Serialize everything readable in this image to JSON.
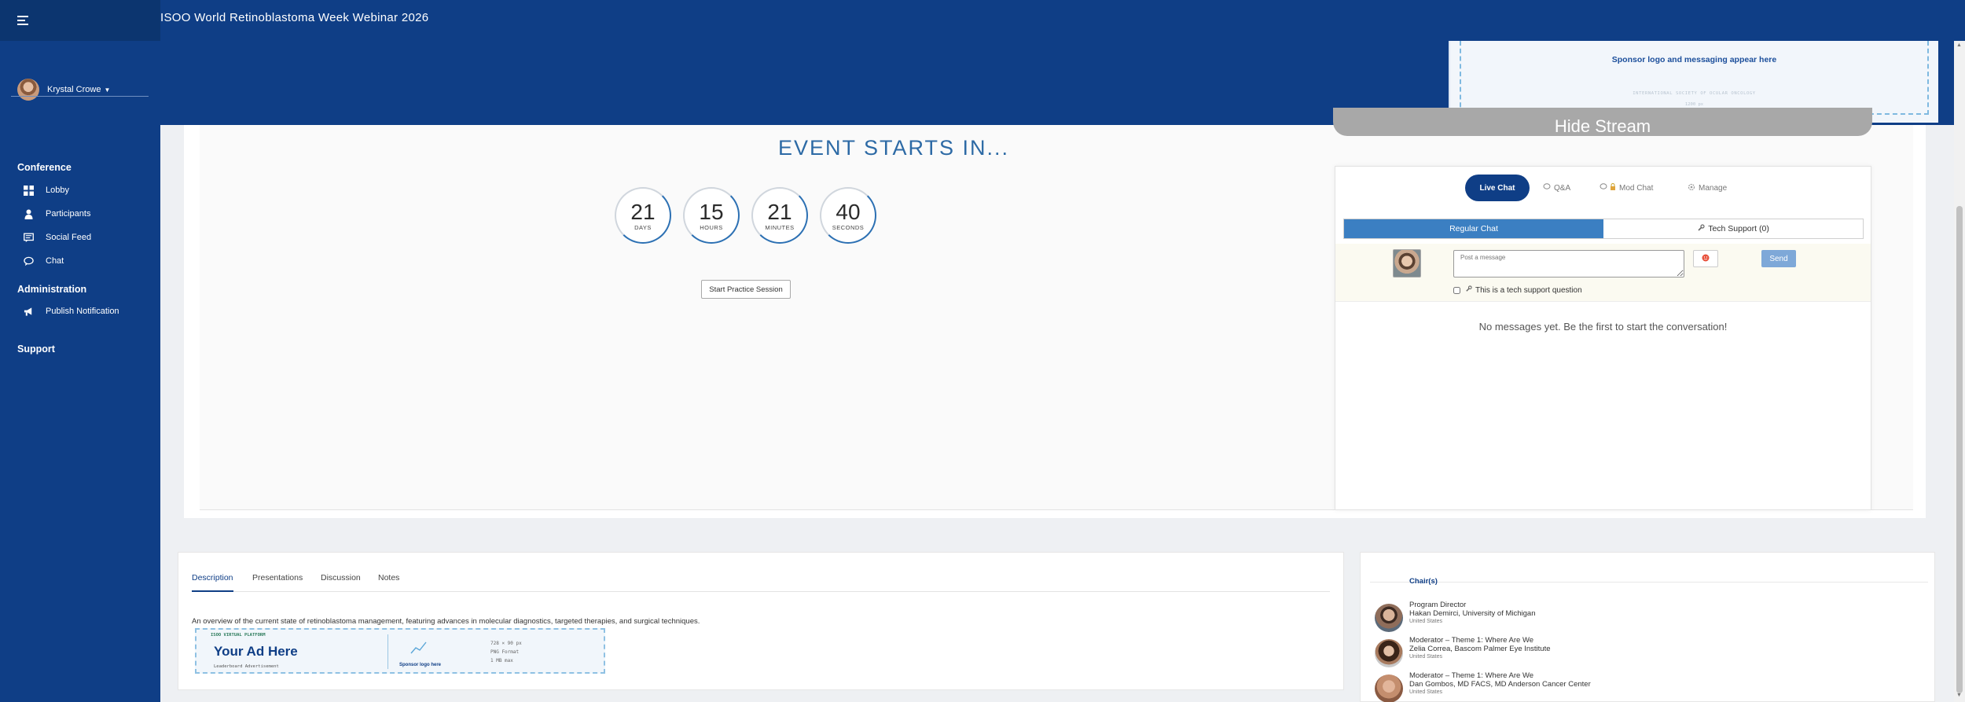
{
  "app": {
    "event_title": "ISOO World Retinoblastoma Week Webinar 2026"
  },
  "user": {
    "name": "Krystal Crowe"
  },
  "sidebar": {
    "sections": [
      {
        "title": "Conference",
        "items": [
          {
            "label": "Lobby",
            "icon": "grid-icon"
          },
          {
            "label": "Participants",
            "icon": "person-icon"
          },
          {
            "label": "Social Feed",
            "icon": "feed-icon"
          },
          {
            "label": "Chat",
            "icon": "chat-bubble-icon"
          }
        ]
      },
      {
        "title": "Administration",
        "items": [
          {
            "label": "Publish Notification",
            "icon": "megaphone-icon"
          }
        ]
      },
      {
        "title": "Support",
        "items": []
      }
    ]
  },
  "sponsor_banner": {
    "text": "Sponsor logo and messaging appear here",
    "sub": "INTERNATIONAL SOCIETY OF OCULAR ONCOLOGY",
    "size": "1200 px"
  },
  "countdown": {
    "title": "EVENT STARTS IN...",
    "units": [
      {
        "value": "21",
        "label": "DAYS"
      },
      {
        "value": "15",
        "label": "HOURS"
      },
      {
        "value": "21",
        "label": "MINUTES"
      },
      {
        "value": "40",
        "label": "SECONDS"
      }
    ],
    "practice_label": "Start Practice Session"
  },
  "stream": {
    "hide_label": "Hide Stream"
  },
  "chat": {
    "tabs": {
      "live": "Live Chat",
      "qa": "Q&A",
      "mod": "Mod Chat",
      "manage": "Manage"
    },
    "subtabs": {
      "regular": "Regular Chat",
      "tech": "Tech Support (0)"
    },
    "input_placeholder": "Post a message",
    "send_label": "Send",
    "tech_question_label": "This is a tech support question",
    "empty_message": "No messages yet. Be the first to start the conversation!"
  },
  "session": {
    "tabs": {
      "description": "Description",
      "presentations": "Presentations",
      "discussion": "Discussion",
      "notes": "Notes"
    },
    "description": "An overview of the current state of retinoblastoma management, featuring advances in molecular diagnostics, targeted therapies, and surgical techniques.",
    "ad": {
      "tag": "ISOO VIRTUAL PLATFORM",
      "headline": "Your Ad Here",
      "sub": "Leaderboard Advertisement",
      "sponsor": "Sponsor logo here",
      "spec1": "728 × 90 px",
      "spec2": "PNG Format",
      "spec3": "1 MB max"
    }
  },
  "chairs": {
    "header": "Chair(s)",
    "people": [
      {
        "role": "Program Director",
        "name": "Hakan Demirci, University of Michigan",
        "country": "United States"
      },
      {
        "role": "Moderator – Theme 1: Where Are We",
        "name": "Zelia Correa, Bascom Palmer Eye Institute",
        "country": "United States"
      },
      {
        "role": "Moderator – Theme 1: Where Are We",
        "name": "Dan Gombos, MD FACS, MD Anderson Cancer Center",
        "country": "United States"
      }
    ]
  },
  "colors": {
    "primary": "#0f3e86",
    "accent": "#2c70b3",
    "chat_active": "#3b7fc2"
  }
}
